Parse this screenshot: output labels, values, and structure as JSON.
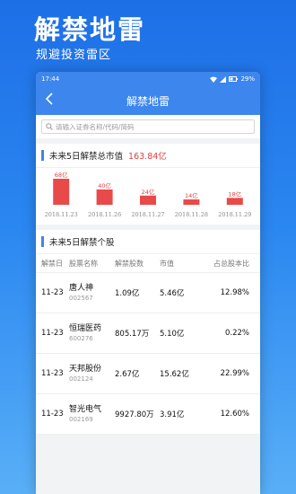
{
  "promo": {
    "title": "解禁地雷",
    "subtitle": "规避投资雷区"
  },
  "statusbar": {
    "time": "17:44",
    "battery": "29%"
  },
  "navbar": {
    "back_icon": "chevron-left-icon",
    "title": "解禁地雷"
  },
  "search": {
    "placeholder": "请输入证券名称/代码/简码",
    "icon": "search-icon"
  },
  "summary": {
    "title": "未来5日解禁总市值",
    "total": "163.84亿"
  },
  "chart_data": {
    "type": "bar",
    "categories": [
      "2018.11.23",
      "2018.11.26",
      "2018.11.27",
      "2018.11.28",
      "2018.11.29"
    ],
    "values": [
      68,
      40,
      24,
      14,
      18
    ],
    "labels": [
      "68亿",
      "40亿",
      "24亿",
      "14亿",
      "18亿"
    ],
    "bar_color": "#e84a4a",
    "grid": false
  },
  "stocks_section": {
    "title": "未来5日解禁个股",
    "columns": [
      "解禁日",
      "股票名称",
      "解禁股数",
      "市值",
      "占总股本比"
    ],
    "rows": [
      {
        "date": "11-23",
        "name": "唐人神",
        "code": "002567",
        "shares": "1.09亿",
        "mcap": "5.46亿",
        "ratio": "12.98%"
      },
      {
        "date": "11-23",
        "name": "恒瑞医药",
        "code": "600276",
        "shares": "805.17万",
        "mcap": "5.10亿",
        "ratio": "0.22%"
      },
      {
        "date": "11-23",
        "name": "天邦股份",
        "code": "002124",
        "shares": "2.67亿",
        "mcap": "15.62亿",
        "ratio": "22.99%"
      },
      {
        "date": "11-23",
        "name": "智光电气",
        "code": "002169",
        "shares": "9927.80万",
        "mcap": "3.91亿",
        "ratio": "12.60%"
      }
    ]
  }
}
